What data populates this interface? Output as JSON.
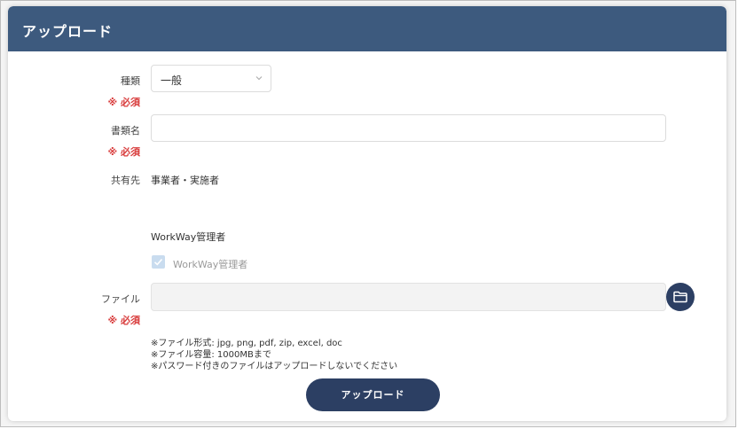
{
  "header": {
    "title": "アップロード"
  },
  "form": {
    "category": {
      "label": "種類",
      "required": "※ 必須",
      "value": "一般"
    },
    "document_name": {
      "label": "書類名",
      "required": "※ 必須",
      "value": "",
      "placeholder": ""
    },
    "share": {
      "label": "共有先",
      "value": "事業者・実施者"
    },
    "admin": {
      "heading": "WorkWay管理者",
      "checkbox_label": "WorkWay管理者",
      "checked": true
    },
    "file": {
      "label": "ファイル",
      "required": "※ 必須",
      "value": "",
      "button_icon": "folder-icon"
    },
    "notes": [
      "※ファイル形式: jpg, png, pdf, zip, excel, doc",
      "※ファイル容量: 1000MBまで",
      "※パスワード付きのファイルはアップロードしないでください"
    ],
    "submit_label": "アップロード"
  },
  "colors": {
    "header_bg": "#3d5a7e",
    "button_bg": "#2c3f63",
    "required_text": "#d83a3a",
    "checkbox_bg": "#c9dcef"
  }
}
